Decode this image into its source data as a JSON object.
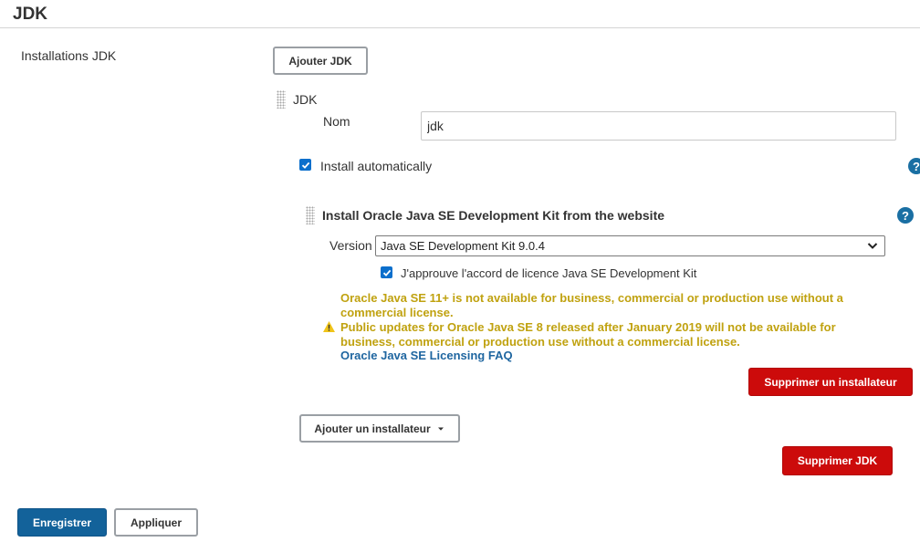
{
  "section": {
    "title": "JDK"
  },
  "installations": {
    "label": "Installations JDK",
    "add_jdk_button": "Ajouter JDK"
  },
  "jdk": {
    "header": "JDK",
    "name_label": "Nom",
    "name_value": "jdk",
    "install_auto_label": "Install automatically",
    "install_auto_checked": true
  },
  "installer": {
    "title": "Install Oracle Java SE Development Kit from the website",
    "version_label": "Version",
    "version_selected": "Java SE Development Kit 9.0.4",
    "license_label": "J'approuve l'accord de licence Java SE Development Kit",
    "license_checked": true,
    "warning_line1": "Oracle Java SE 11+ is not available for business, commercial or production use without a commercial license.",
    "warning_line2": "Public updates for Oracle Java SE 8 released after January 2019 will not be available for business, commercial or production use without a commercial license.",
    "faq_link": "Oracle Java SE Licensing FAQ",
    "remove_installer_button": "Supprimer un installateur"
  },
  "add_installer_button": "Ajouter un installateur",
  "remove_jdk_button": "Supprimer JDK",
  "footer": {
    "save_button": "Enregistrer",
    "apply_button": "Appliquer"
  },
  "colors": {
    "warning": "#c0a210",
    "danger": "#cc0b0b",
    "primary": "#13629a",
    "link": "#1f66a0"
  },
  "icons": {
    "help": "help-icon",
    "warning": "warning-triangle-icon",
    "drag": "drag-handle-icon",
    "caret": "caret-down-icon"
  }
}
